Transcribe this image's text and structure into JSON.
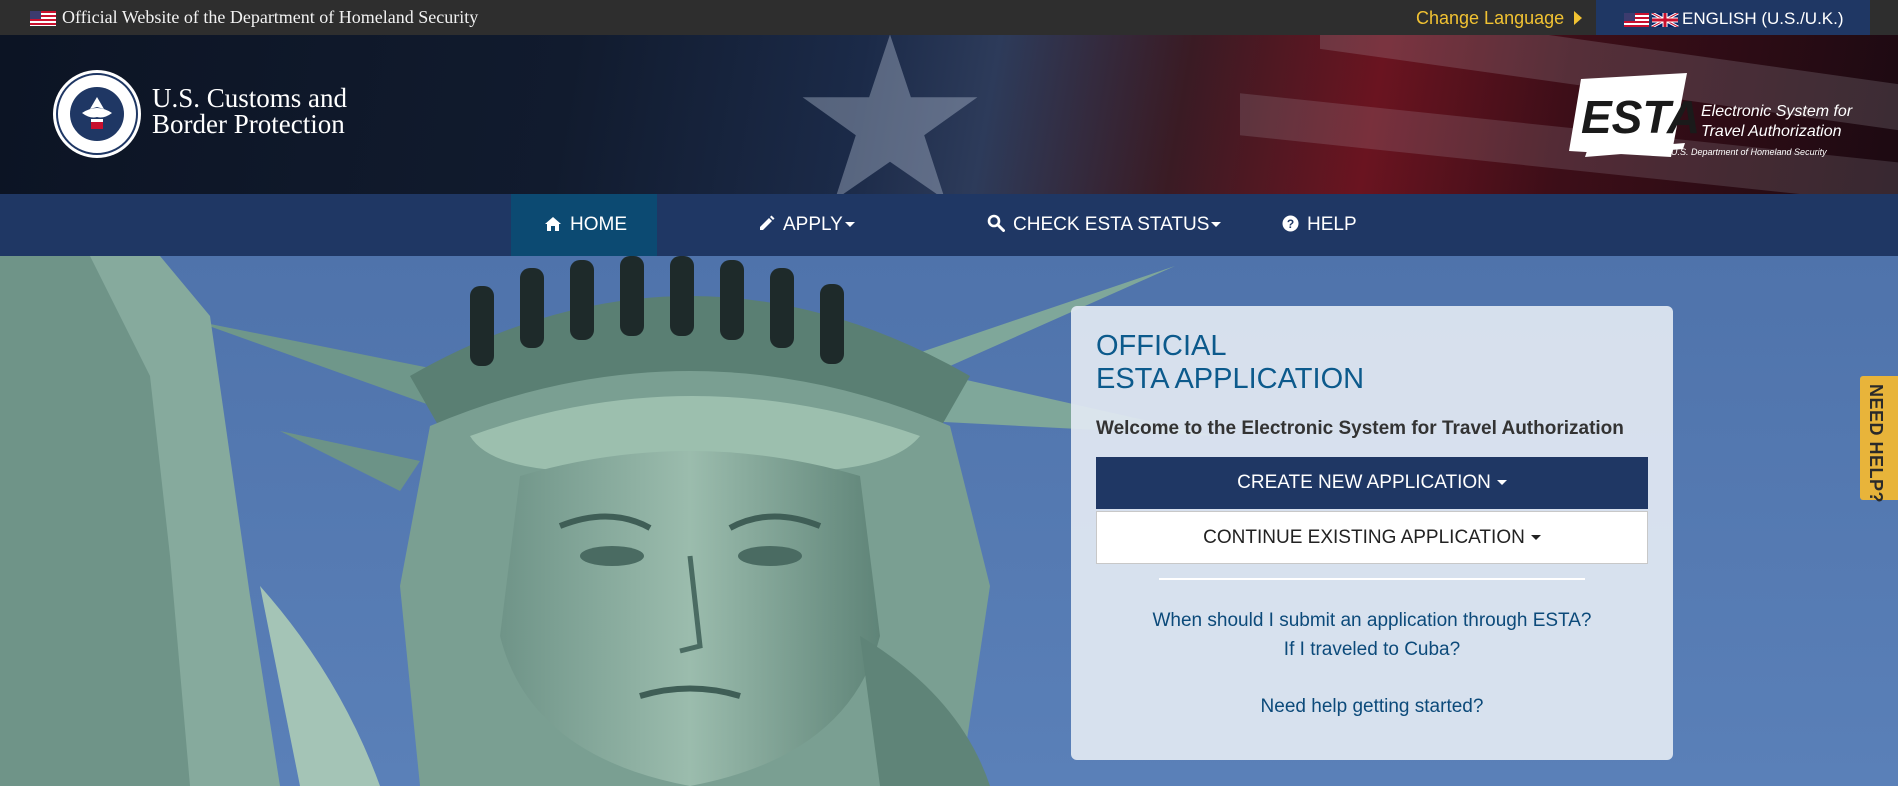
{
  "gov_bar": {
    "text": "Official Website of the Department of Homeland Security",
    "change_language": "Change Language",
    "language": "ENGLISH (U.S./U.K.)"
  },
  "banner": {
    "agency_line1": "U.S. Customs and",
    "agency_line2": "Border Protection",
    "esta_logo_text": "ESTA",
    "esta_tagline1": "Electronic System for",
    "esta_tagline2": "Travel Authorization",
    "esta_subline": "U.S. Department of Homeland Security"
  },
  "nav": {
    "items": [
      {
        "label": "HOME",
        "icon": "home-icon"
      },
      {
        "label": "APPLY",
        "icon": "pencil-icon"
      },
      {
        "label": "CHECK ESTA STATUS",
        "icon": "search-icon"
      },
      {
        "label": "HELP",
        "icon": "question-circle-icon"
      }
    ]
  },
  "card": {
    "title_line1": "OFFICIAL",
    "title_line2": "ESTA APPLICATION",
    "welcome": "Welcome to the Electronic System for Travel Authorization",
    "create_button": "CREATE NEW APPLICATION",
    "continue_button": "CONTINUE EXISTING APPLICATION",
    "link1": "When should I submit an application through ESTA?",
    "link2": "If I traveled to Cuba?",
    "link3": "Need help getting started?"
  },
  "side_tab": "NEED HELP?",
  "colors": {
    "navy": "#1f3764",
    "active_nav": "#0c4a72",
    "gold": "#f1c232",
    "link": "#0c4a7a"
  }
}
